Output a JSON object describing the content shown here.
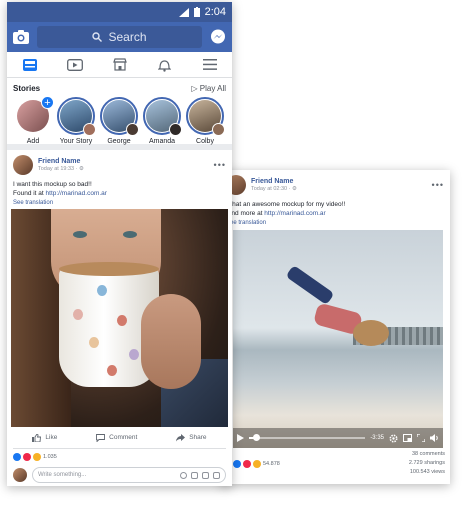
{
  "status": {
    "time": "2:04"
  },
  "topbar": {
    "search_placeholder": "Search"
  },
  "stories": {
    "title": "Stories",
    "play_all": "Play All",
    "items": [
      {
        "name": "Add",
        "colors": [
          "#d9a0a0",
          "#7a4f4f"
        ]
      },
      {
        "name": "Your Story",
        "colors": [
          "#7fa6c9",
          "#2e4a6b"
        ]
      },
      {
        "name": "George",
        "colors": [
          "#9bb8d9",
          "#37516f"
        ]
      },
      {
        "name": "Amanda",
        "colors": [
          "#a7c2dc",
          "#546879"
        ]
      },
      {
        "name": "Colby",
        "colors": [
          "#c7b49c",
          "#5b4a3a"
        ]
      }
    ]
  },
  "post": {
    "author": "Friend Name",
    "meta": "Today at 19:33 · ⚙",
    "text_line1": "I want this mockup so bad!!",
    "text_prefix": "Found it at ",
    "link": "http://marinad.com.ar",
    "see_translation": "See translation",
    "like": "Like",
    "comment": "Comment",
    "share": "Share",
    "reaction_count": "1.035",
    "comment_placeholder": "Write something..."
  },
  "video_post": {
    "author": "Friend Name",
    "meta": "Today at 02:30 · ⚙",
    "text_line1": "What an awesome mockup for my video!!",
    "text_prefix": "Find more at ",
    "link": "http://marinad.com.ar",
    "see_translation": "See translation",
    "time_remaining": "-3:35",
    "progress": 0.06,
    "reaction_count": "54.878",
    "comments": "38 comments",
    "shares": "2.729 sharings",
    "views": "100.543 views"
  },
  "colors": {
    "brand": "#4267b2",
    "brand_dark": "#3b5998",
    "link": "#385898"
  }
}
